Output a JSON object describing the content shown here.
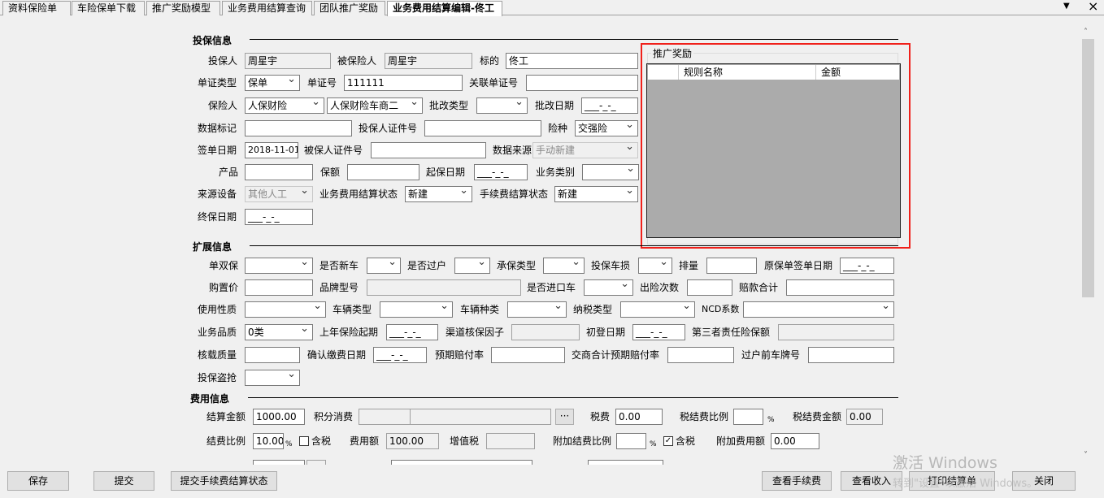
{
  "tabs": [
    "资料保险单",
    "车险保单下载",
    "推广奖励模型",
    "业务费用结算查询",
    "团队推广奖励",
    "业务费用结算编辑-佟工"
  ],
  "tab_controls": {
    "dropdown": "▼",
    "close": "×"
  },
  "sections": {
    "insure": "投保信息",
    "extend": "扩展信息",
    "fee": "费用信息"
  },
  "insure": {
    "applicant_label": "投保人",
    "applicant": "周星宇",
    "insured_label": "被保险人",
    "insured": "周星宇",
    "subject_label": "标的",
    "subject": "佟工",
    "doc_type_label": "单证类型",
    "doc_type": "保单",
    "doc_no_label": "单证号",
    "doc_no": "111111",
    "related_doc_label": "关联单证号",
    "insurer_label": "保险人",
    "insurer": "人保财险",
    "insurer_branch": "人保财险车商二",
    "endorse_type_label": "批改类型",
    "endorse_date_label": "批改日期",
    "date_mask": "___-_-_",
    "data_mark_label": "数据标记",
    "applicant_id_label": "投保人证件号",
    "risk_type_label": "险种",
    "risk_type": "交强险",
    "sign_date_label": "签单日期",
    "sign_date": "2018-11-01",
    "insured_id_label": "被保人证件号",
    "data_source_label": "数据来源",
    "data_source": "手动新建",
    "product_label": "产品",
    "amount_label": "保额",
    "start_date_label": "起保日期",
    "biz_category_label": "业务类别",
    "source_device_label": "来源设备",
    "source_device": "其他人工",
    "biz_fee_status_label": "业务费用结算状态",
    "biz_fee_status": "新建",
    "commission_status_label": "手续费结算状态",
    "commission_status": "新建",
    "end_date_label": "终保日期"
  },
  "reward": {
    "title": "推广奖励",
    "columns": [
      "",
      "规则名称",
      "金额"
    ]
  },
  "extend": {
    "single_double_label": "单双保",
    "new_car_label": "是否新车",
    "transfer_label": "是否过户",
    "underwrite_type_label": "承保类型",
    "car_damage_label": "投保车损",
    "displacement_label": "排量",
    "orig_sign_date_label": "原保单签单日期",
    "purchase_price_label": "购置价",
    "brand_model_label": "品牌型号",
    "imported_label": "是否进口车",
    "claim_count_label": "出险次数",
    "claim_total_label": "赔款合计",
    "usage_label": "使用性质",
    "vehicle_type_label": "车辆类型",
    "vehicle_kind_label": "车辆种类",
    "tax_type_label": "纳税类型",
    "ncd_label": "NCD系数",
    "biz_quality_label": "业务品质",
    "biz_quality": "0类",
    "last_year_start_label": "上年保险起期",
    "channel_factor_label": "渠道核保因子",
    "first_reg_label": "初登日期",
    "third_party_label": "第三者责任险保额",
    "load_label": "核载质量",
    "pay_confirm_label": "确认缴费日期",
    "expected_loss_label": "预期赔付率",
    "combined_loss_label": "交商合计预期赔付率",
    "prev_plate_label": "过户前车牌号",
    "theft_label": "投保盗抢"
  },
  "fee": {
    "settle_amount_label": "结算金额",
    "settle_amount": "1000.00",
    "points_label": "积分消费",
    "more": "···",
    "tax_label": "税费",
    "tax": "0.00",
    "tax_ratio_label": "税结费比例",
    "percent": "%",
    "tax_amount_label": "税结费金额",
    "tax_amount": "0.00",
    "fee_ratio_label": "结费比例",
    "fee_ratio": "10.00",
    "incl_tax_label": "含税",
    "fee_amount_label": "费用额",
    "fee_amount": "100.00",
    "vat_label": "增值税",
    "extra_ratio_label": "附加结费比例",
    "extra_incl_tax_label": "含税",
    "extra_amount_label": "附加费用额",
    "extra_amount": "0.00"
  },
  "buttons": {
    "save": "保存",
    "submit": "提交",
    "submit_status": "提交手续费结算状态",
    "view_commission": "查看手续费",
    "view_income": "查看收入",
    "print": "打印结算单",
    "close": "关闭"
  },
  "watermark": {
    "line1": "激活 Windows",
    "line2": "转到\"设置\"以激活 Windows。"
  }
}
